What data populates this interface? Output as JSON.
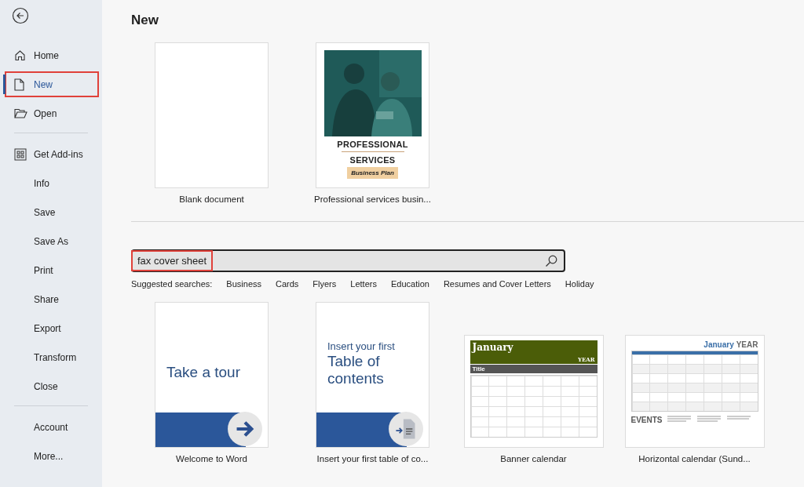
{
  "sidebar": {
    "groups": [
      {
        "items": [
          {
            "label": "Home",
            "kind": "home",
            "selected": false,
            "highlighted": false
          },
          {
            "label": "New",
            "kind": "new",
            "selected": true,
            "highlighted": true
          },
          {
            "label": "Open",
            "kind": "open",
            "selected": false,
            "highlighted": false
          }
        ]
      },
      {
        "items": [
          {
            "label": "Get Add-ins",
            "kind": "addins",
            "selected": false,
            "highlighted": false
          },
          {
            "label": "Info",
            "kind": "plain",
            "selected": false,
            "highlighted": false
          },
          {
            "label": "Save",
            "kind": "plain",
            "selected": false,
            "highlighted": false
          },
          {
            "label": "Save As",
            "kind": "plain",
            "selected": false,
            "highlighted": false
          },
          {
            "label": "Print",
            "kind": "plain",
            "selected": false,
            "highlighted": false
          },
          {
            "label": "Share",
            "kind": "plain",
            "selected": false,
            "highlighted": false
          },
          {
            "label": "Export",
            "kind": "plain",
            "selected": false,
            "highlighted": false
          },
          {
            "label": "Transform",
            "kind": "plain",
            "selected": false,
            "highlighted": false
          },
          {
            "label": "Close",
            "kind": "plain",
            "selected": false,
            "highlighted": false
          }
        ]
      },
      {
        "items": [
          {
            "label": "Account",
            "kind": "plain",
            "selected": false,
            "highlighted": false
          },
          {
            "label": "More...",
            "kind": "plain",
            "selected": false,
            "highlighted": false
          }
        ]
      }
    ]
  },
  "heading": "New",
  "featured": [
    {
      "kind": "blank",
      "label": "Blank document"
    },
    {
      "kind": "cover",
      "label": "Professional services busin...",
      "texts": [
        "PROFESSIONAL",
        "SERVICES",
        "Business Plan"
      ]
    }
  ],
  "search": {
    "value": "fax cover sheet",
    "highlighted": true
  },
  "suggested": {
    "label": "Suggested searches:",
    "items": [
      "Business",
      "Cards",
      "Flyers",
      "Letters",
      "Education",
      "Resumes and Cover Letters",
      "Holiday"
    ]
  },
  "templates": [
    {
      "kind": "tour",
      "label": "Welcome to Word",
      "texts": [
        "Take a tour"
      ]
    },
    {
      "kind": "toc",
      "label": "Insert your first table of co...",
      "texts": [
        "Insert your first",
        "Table of contents"
      ]
    },
    {
      "kind": "banner-calendar",
      "label": "Banner calendar",
      "texts": [
        "January",
        "YEAR",
        "Title"
      ]
    },
    {
      "kind": "horizontal-calendar",
      "label": "Horizontal calendar (Sund...",
      "texts": [
        "January",
        "YEAR",
        "EVENTS"
      ]
    }
  ]
}
